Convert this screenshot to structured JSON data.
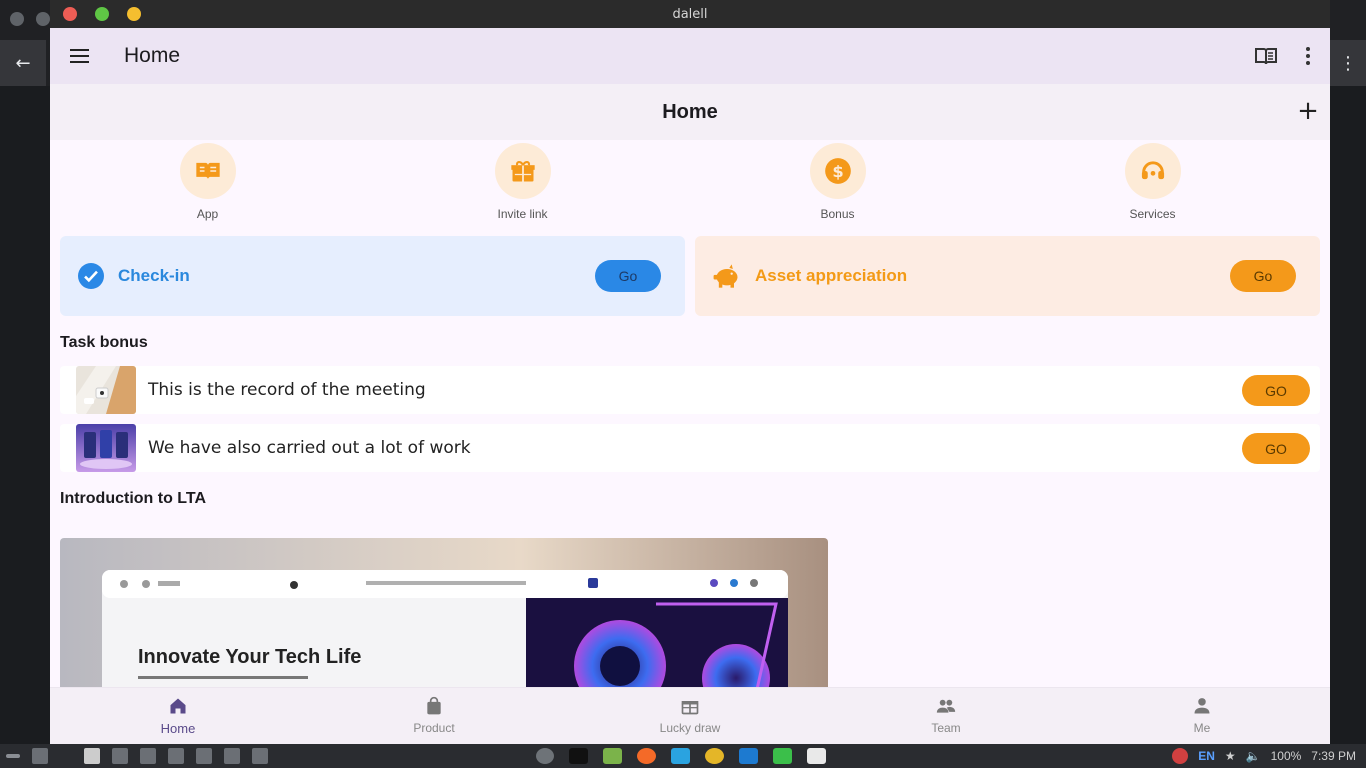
{
  "window": {
    "title": "dalell"
  },
  "appbar": {
    "title": "Home"
  },
  "subheader": {
    "title": "Home",
    "add_label": "+"
  },
  "quick_actions": [
    {
      "label": "App",
      "icon": "book-icon"
    },
    {
      "label": "Invite link",
      "icon": "gift-icon"
    },
    {
      "label": "Bonus",
      "icon": "dollar-icon"
    },
    {
      "label": "Services",
      "icon": "headset-icon"
    }
  ],
  "cards": {
    "checkin": {
      "label": "Check-in",
      "button": "Go",
      "icon": "check-icon"
    },
    "asset": {
      "label": "Asset appreciation",
      "button": "Go",
      "icon": "piggy-bank-icon"
    }
  },
  "task_section": {
    "title": "Task bonus"
  },
  "tasks": [
    {
      "text": "This is the record of the meeting",
      "button": "GO"
    },
    {
      "text": "We have also carried out a lot of work",
      "button": "GO"
    }
  ],
  "intro": {
    "title": "Introduction to LTA",
    "banner_headline": "Innovate Your Tech Life"
  },
  "bottom_nav": [
    {
      "label": "Home",
      "icon": "home-icon",
      "active": true
    },
    {
      "label": "Product",
      "icon": "bag-icon",
      "active": false
    },
    {
      "label": "Lucky draw",
      "icon": "gift-icon",
      "active": false
    },
    {
      "label": "Team",
      "icon": "team-icon",
      "active": false
    },
    {
      "label": "Me",
      "icon": "person-icon",
      "active": false
    }
  ],
  "taskbar": {
    "lang": "EN",
    "battery": "100%",
    "time": "7:39 PM"
  },
  "colors": {
    "accent_orange": "#f4991a",
    "accent_blue": "#2a88e6",
    "appbar_bg": "#ece4f3",
    "page_bg": "#fdf7ff"
  }
}
